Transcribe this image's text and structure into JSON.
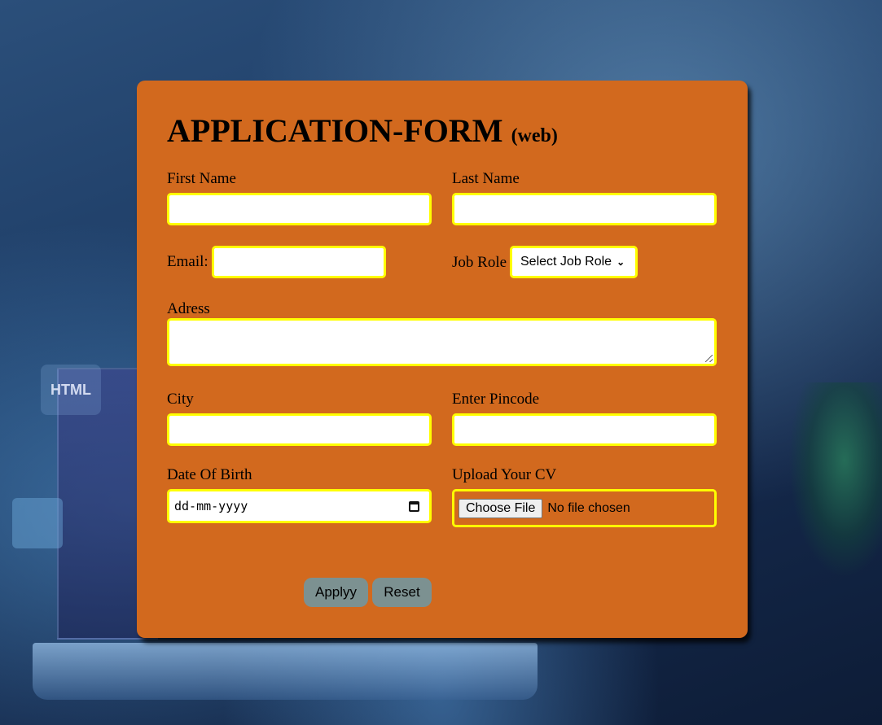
{
  "form": {
    "title": "APPLICATION-FORM",
    "title_suffix": "(web)",
    "first_name_label": "First Name",
    "last_name_label": "Last Name",
    "email_label": "Email:",
    "job_role_label": "Job Role",
    "job_role_selected": "Select Job Role",
    "address_label": "Adress",
    "city_label": "City",
    "pincode_label": "Enter Pincode",
    "dob_label": "Date Of Birth",
    "dob_placeholder": "dd-mm-yyyy",
    "cv_label": "Upload Your CV",
    "file_button": "Choose File",
    "file_status": "No file chosen",
    "apply_button": "Applyy",
    "reset_button": "Reset"
  },
  "background": {
    "html_badge": "HTML"
  },
  "colors": {
    "card": "#d2691e",
    "field_border": "#ffff00",
    "button": "#7c9191"
  }
}
